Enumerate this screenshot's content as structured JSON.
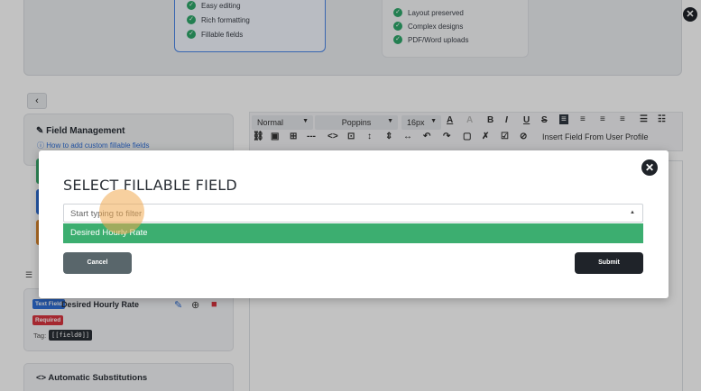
{
  "features_left": [
    "Easy editing",
    "Rich formatting",
    "Fillable fields"
  ],
  "features_right": [
    "Layout preserved",
    "Complex designs",
    "PDF/Word uploads"
  ],
  "back_label": "‹",
  "field_management": {
    "title": "Field Management",
    "help_link": "How to add custom fillable fields"
  },
  "toolbar": {
    "style_select": "Normal",
    "font_select": "Poppins",
    "size_select": "16px",
    "insert_profile": "Insert Field From User Profile"
  },
  "field_item": {
    "type_badge": "Text Field",
    "name": "Desired Hourly Rate",
    "required_badge": "Required",
    "tag_label": "Tag:",
    "tag_value": "[[field0]]"
  },
  "auto_sub": {
    "title": "Automatic Substitutions"
  },
  "modal": {
    "title": "SELECT FILLABLE FIELD",
    "filter_placeholder": "Start typing to filter",
    "filter_value": "",
    "option": "Desired Hourly Rate",
    "cancel_label": "Cancel",
    "submit_label": "Submit"
  },
  "colors": {
    "accent_green": "#3cae70",
    "dark_button": "#1f2329",
    "cancel_button": "#59666b",
    "link_blue": "#2f6fd6",
    "required_red": "#d93540"
  }
}
